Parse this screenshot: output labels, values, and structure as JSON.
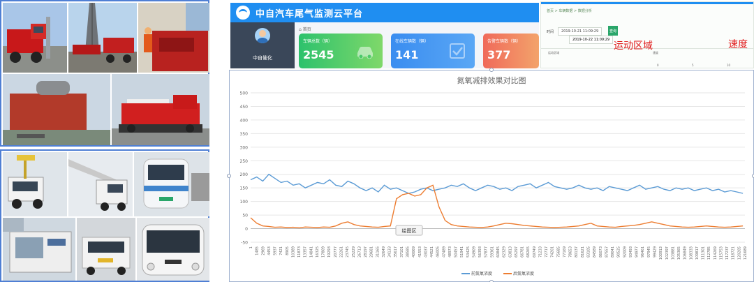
{
  "platform": {
    "title": "中自汽车尾气监测云平台",
    "user_name": "中自催化",
    "breadcrumb": "首页",
    "cards": [
      {
        "label": "车辆总数（辆）",
        "value": "2545",
        "icon": "car-icon",
        "color": "#2dc26c"
      },
      {
        "label": "在线车辆数（辆）",
        "value": "141",
        "icon": "check-icon",
        "color": "#3a8df0"
      },
      {
        "label": "告警车辆数（辆）",
        "value": "377",
        "icon": "alert-icon",
        "color": "#f06a5a"
      }
    ]
  },
  "fragment": {
    "crumb": "首页 > 车辆数据 > 数据分析",
    "date_label": "时间",
    "date_from": "2019-10-21 11:09:29",
    "date_to": "2019-10-22 11:09:29",
    "query_button": "查询",
    "map_label": "运动区域",
    "speed_label": "速度",
    "overlay_motion": "运动区域",
    "overlay_speed": "速度",
    "ticks": [
      "0",
      "5",
      "10"
    ]
  },
  "chart_data": {
    "type": "line",
    "title": "氮氧减排效果对比图",
    "ylim": [
      -50,
      500
    ],
    "yticks": [
      -50,
      0,
      50,
      100,
      150,
      200,
      250,
      300,
      350,
      400,
      450,
      500
    ],
    "xlim": [
      1,
      122000
    ],
    "x_tick_labels": [
      "1",
      "1485",
      "2969",
      "4453",
      "5937",
      "7421",
      "8905",
      "10389",
      "11873",
      "13357",
      "14841",
      "16325",
      "17809",
      "19293",
      "20777",
      "22261",
      "23745",
      "25229",
      "26713",
      "28197",
      "29681",
      "31165",
      "32649",
      "34133",
      "35617",
      "37101",
      "38585",
      "40069",
      "41553",
      "43037",
      "44521",
      "46005",
      "47489",
      "48973",
      "50457",
      "51941",
      "53425",
      "54909",
      "56393",
      "57877",
      "59361",
      "60845",
      "62329",
      "63813",
      "65297",
      "66781",
      "68265",
      "69749",
      "71233",
      "72717",
      "74201",
      "75685",
      "77169",
      "78653",
      "80137",
      "81621",
      "83105",
      "84589",
      "86073",
      "87557",
      "89041",
      "90525",
      "92009",
      "93493",
      "94977",
      "96461",
      "97945",
      "99429",
      "100913",
      "102397",
      "103881",
      "105365",
      "106849",
      "108333",
      "109817",
      "111301",
      "112785",
      "114269",
      "115753",
      "117237",
      "118721",
      "120205",
      "121689"
    ],
    "grid": true,
    "legend_position": "bottom",
    "tooltip_label": "绘图区",
    "series": [
      {
        "name": "前氮氧浓度",
        "color": "#5b9bd5",
        "x": [
          1,
          1500,
          3000,
          4500,
          6000,
          7500,
          9000,
          10500,
          12000,
          13500,
          15000,
          16500,
          18000,
          19500,
          21000,
          22500,
          24000,
          25500,
          27000,
          28500,
          30000,
          31500,
          33000,
          34500,
          36000,
          37500,
          39000,
          40500,
          42000,
          43500,
          45000,
          46500,
          48000,
          49500,
          51000,
          52500,
          54000,
          55500,
          57000,
          58500,
          60000,
          61500,
          63000,
          64500,
          66000,
          67500,
          69000,
          70500,
          72000,
          73500,
          75000,
          76500,
          78000,
          79500,
          81000,
          82500,
          84000,
          85500,
          87000,
          88500,
          90000,
          91500,
          93000,
          94500,
          96000,
          97500,
          99000,
          100500,
          102000,
          103500,
          105000,
          106500,
          108000,
          109500,
          111000,
          112500,
          114000,
          115500,
          117000,
          118500,
          120000,
          121500
        ],
        "y": [
          180,
          190,
          175,
          200,
          185,
          170,
          175,
          160,
          165,
          150,
          160,
          170,
          165,
          180,
          160,
          155,
          175,
          165,
          150,
          140,
          150,
          135,
          160,
          145,
          150,
          140,
          130,
          135,
          145,
          150,
          140,
          145,
          150,
          160,
          155,
          165,
          150,
          140,
          150,
          160,
          155,
          145,
          150,
          140,
          155,
          160,
          165,
          150,
          160,
          170,
          155,
          150,
          145,
          150,
          160,
          150,
          145,
          150,
          140,
          155,
          150,
          145,
          140,
          150,
          160,
          145,
          150,
          155,
          145,
          140,
          150,
          145,
          150,
          140,
          145,
          150,
          140,
          145,
          135,
          140,
          135,
          130
        ]
      },
      {
        "name": "后氮氧浓度",
        "color": "#ed7d31",
        "x": [
          1,
          1500,
          3000,
          4500,
          6000,
          7500,
          9000,
          10500,
          12000,
          13500,
          15000,
          16500,
          18000,
          19500,
          21000,
          22500,
          24000,
          25500,
          27000,
          28500,
          30000,
          31500,
          33000,
          34500,
          36000,
          37500,
          39000,
          40500,
          42000,
          43500,
          45000,
          46500,
          48000,
          49500,
          51000,
          52500,
          54000,
          55500,
          57000,
          58500,
          60000,
          61500,
          63000,
          64500,
          66000,
          67500,
          69000,
          70500,
          72000,
          73500,
          75000,
          76500,
          78000,
          79500,
          81000,
          82500,
          84000,
          85500,
          87000,
          88500,
          90000,
          91500,
          93000,
          94500,
          96000,
          97500,
          99000,
          100500,
          102000,
          103500,
          105000,
          106500,
          108000,
          109500,
          111000,
          112500,
          114000,
          115500,
          117000,
          118500,
          120000,
          121500
        ],
        "y": [
          40,
          20,
          10,
          8,
          5,
          6,
          4,
          5,
          3,
          6,
          5,
          4,
          6,
          5,
          10,
          20,
          25,
          15,
          10,
          8,
          6,
          5,
          8,
          10,
          110,
          125,
          130,
          120,
          125,
          150,
          160,
          80,
          30,
          15,
          10,
          8,
          6,
          5,
          4,
          6,
          10,
          15,
          20,
          18,
          15,
          12,
          10,
          8,
          6,
          5,
          4,
          5,
          6,
          8,
          10,
          15,
          20,
          10,
          8,
          6,
          5,
          8,
          10,
          12,
          15,
          20,
          25,
          20,
          15,
          10,
          8,
          6,
          5,
          6,
          8,
          10,
          8,
          6,
          5,
          6,
          8,
          10
        ]
      }
    ]
  },
  "collage": {
    "top_photos": [
      "red-drilling-truck-photo",
      "drilling-rig-photo",
      "workers-machinery-photo",
      "exhaust-unit-photo",
      "red-fire-vehicle-photo"
    ],
    "bottom_photos": [
      "aerial-lift-truck-photo",
      "mobile-crane-photo",
      "tourist-bus-photo",
      "generator-unit-photo",
      "small-utility-truck-photo",
      "city-bus-photo"
    ]
  }
}
